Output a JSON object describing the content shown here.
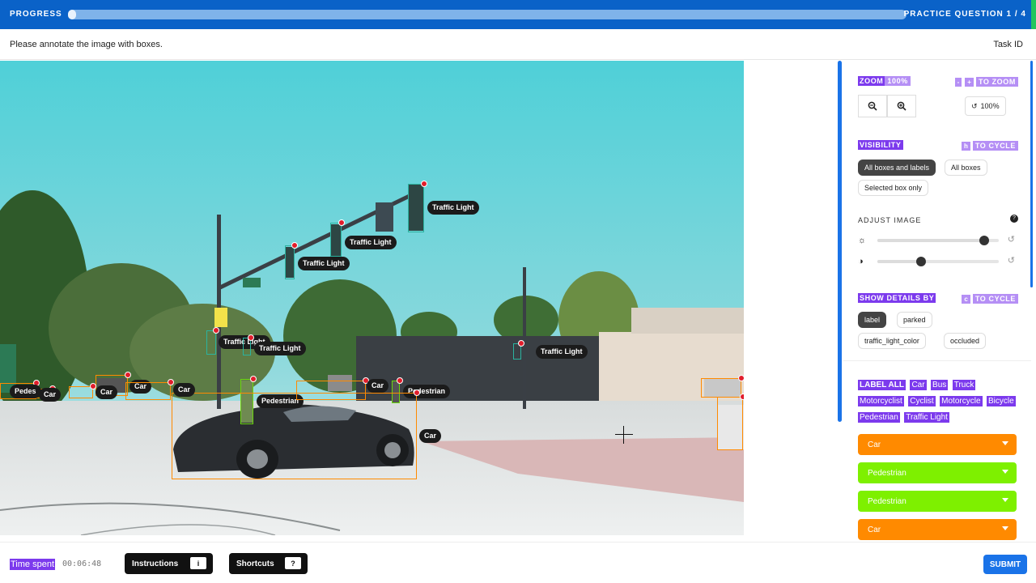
{
  "header": {
    "progress_label": "PROGRESS",
    "progress_fraction": 0.01,
    "practice_label": "PRACTICE QUESTION 1 / 4"
  },
  "instruction": {
    "text": "Please annotate the image with boxes.",
    "task_id_label": "Task ID"
  },
  "canvas": {
    "annotations": [
      {
        "label": "Traffic Light"
      },
      {
        "label": "Traffic Light"
      },
      {
        "label": "Traffic Light"
      },
      {
        "label": "Traffic Light"
      },
      {
        "label": "Traffic Light"
      },
      {
        "label": "Traffic Light"
      },
      {
        "label": "Pedestrian"
      },
      {
        "label": "Pedestrian"
      },
      {
        "label": "Car"
      },
      {
        "label": "Car"
      },
      {
        "label": "Car"
      },
      {
        "label": "Car"
      },
      {
        "label": "Car"
      },
      {
        "label": "Car"
      },
      {
        "label": "Car"
      },
      {
        "label": "Car"
      },
      {
        "label": "Pedes"
      }
    ]
  },
  "panel": {
    "zoom": {
      "label": "ZOOM",
      "value": "100%",
      "key_minus": "-",
      "key_plus": "+",
      "hint": "TO ZOOM",
      "reset_label": "100%"
    },
    "visibility": {
      "label": "VISIBILITY",
      "key": "h",
      "hint": "TO CYCLE",
      "options": [
        "All boxes and labels",
        "All boxes",
        "Selected box only"
      ],
      "selected": "All boxes and labels"
    },
    "adjust": {
      "label": "ADJUST IMAGE",
      "brightness": 0.88,
      "contrast": 0.36
    },
    "details": {
      "label": "SHOW DETAILS BY",
      "key": "c",
      "hint": "TO CYCLE",
      "options": [
        "label",
        "parked",
        "traffic_light_color",
        "occluded"
      ],
      "selected": "label"
    },
    "label_all": [
      "LABEL ALL",
      "Car",
      "Bus",
      "Truck",
      "Motorcyclist",
      "Cyclist",
      "Motorcycle",
      "Bicycle",
      "Pedestrian",
      "Traffic Light"
    ],
    "annotation_list": [
      "Car",
      "Pedestrian",
      "Pedestrian",
      "Car"
    ]
  },
  "footer": {
    "time_label": "Time spent",
    "time_value": "00:06:48",
    "instructions_label": "Instructions",
    "instructions_key": "i",
    "shortcuts_label": "Shortcuts",
    "shortcuts_key": "?",
    "submit_label": "SUBMIT"
  },
  "colors": {
    "car": "#ff8a00",
    "pedestrian": "#7ef000",
    "traffic_light": "#2bb3a0",
    "accent": "#1a73e8",
    "highlight": "#7c3aed"
  }
}
